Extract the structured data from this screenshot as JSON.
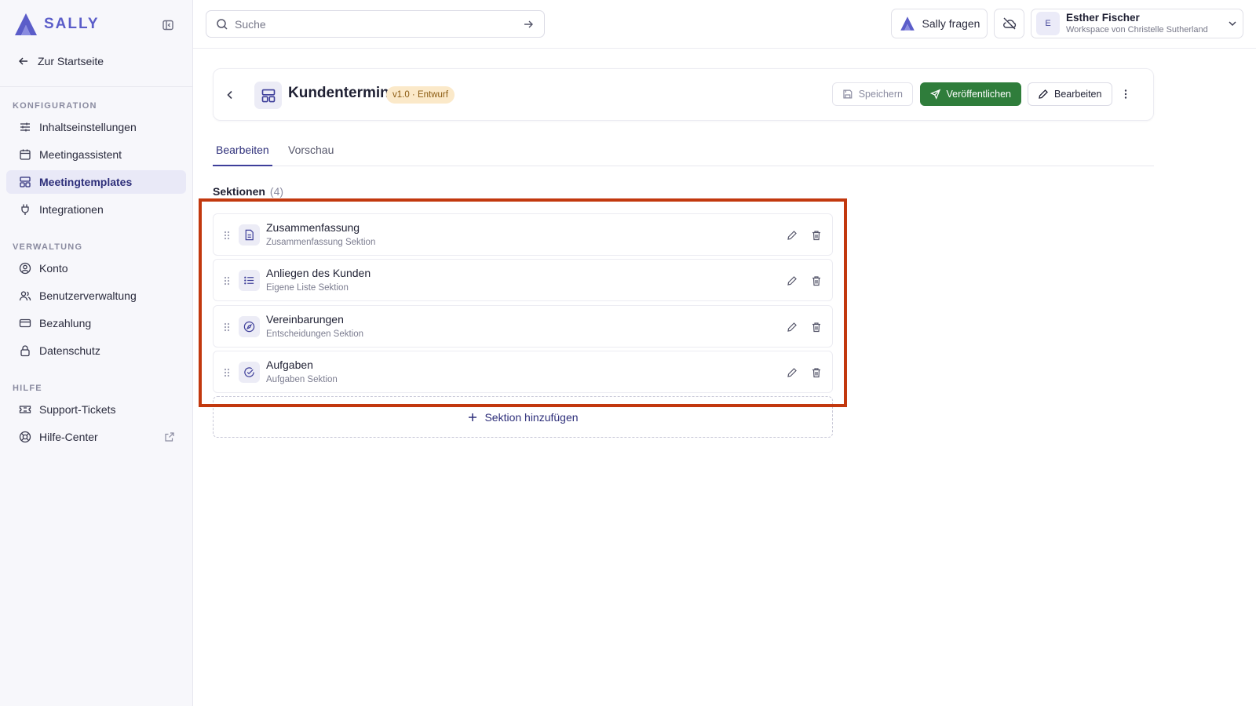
{
  "app": {
    "brand": "SALLY",
    "accent": "#5b5dc9",
    "publish_color": "#2f7d3b",
    "highlight_color": "#c2380e"
  },
  "sidebar": {
    "home_label": "Zur Startseite",
    "groups": [
      {
        "label": "KONFIGURATION",
        "items": [
          {
            "label": "Inhaltseinstellungen",
            "icon": "sliders-icon"
          },
          {
            "label": "Meetingassistent",
            "icon": "calendar-icon"
          },
          {
            "label": "Meetingtemplates",
            "icon": "layout-template-icon",
            "active": true
          },
          {
            "label": "Integrationen",
            "icon": "plug-icon"
          }
        ]
      },
      {
        "label": "VERWALTUNG",
        "items": [
          {
            "label": "Konto",
            "icon": "user-circle-icon"
          },
          {
            "label": "Benutzerverwaltung",
            "icon": "users-icon"
          },
          {
            "label": "Bezahlung",
            "icon": "credit-card-icon"
          },
          {
            "label": "Datenschutz",
            "icon": "lock-icon"
          }
        ]
      },
      {
        "label": "HILFE",
        "items": [
          {
            "label": "Support-Tickets",
            "icon": "ticket-icon"
          },
          {
            "label": "Hilfe-Center",
            "icon": "life-buoy-icon",
            "external": true
          }
        ]
      }
    ]
  },
  "topbar": {
    "search_placeholder": "Suche",
    "ask_label": "Sally fragen",
    "user": {
      "initial": "E",
      "name": "Esther Fischer",
      "workspace": "Workspace von Christelle Sutherland"
    }
  },
  "template": {
    "title": "Kundentermin",
    "version_badge": "v1.0 · Entwurf",
    "save_label": "Speichern",
    "publish_label": "Veröffentlichen",
    "edit_label": "Bearbeiten"
  },
  "tabs": [
    {
      "label": "Bearbeiten",
      "active": true
    },
    {
      "label": "Vorschau",
      "active": false
    }
  ],
  "sections": {
    "heading": "Sektionen",
    "count": "(4)",
    "add_label": "Sektion hinzufügen",
    "items": [
      {
        "title": "Zusammenfassung",
        "subtitle": "Zusammenfassung Sektion",
        "icon": "document-icon"
      },
      {
        "title": "Anliegen des Kunden",
        "subtitle": "Eigene Liste Sektion",
        "icon": "list-icon"
      },
      {
        "title": "Vereinbarungen",
        "subtitle": "Entscheidungen Sektion",
        "icon": "compass-icon"
      },
      {
        "title": "Aufgaben",
        "subtitle": "Aufgaben Sektion",
        "icon": "check-circle-icon"
      }
    ]
  }
}
